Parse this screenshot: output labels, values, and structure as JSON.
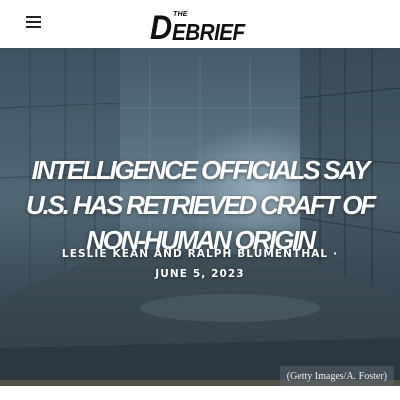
{
  "header": {
    "menu_icon": "hamburger-menu-icon",
    "logo": {
      "small_text": "THE",
      "initial": "D",
      "rest": "EBRIEF"
    }
  },
  "article": {
    "headline": "Intelligence Officials Say U.S. Has Retrieved Craft of Non-Human Origin",
    "author_1": "LESLIE KEAN",
    "author_joiner": "AND",
    "author_2": "RALPH BLUMENTHAL",
    "separator": "·",
    "date": "JUNE 5, 2023",
    "image_credit": "(Getty Images/A. Foster)"
  }
}
